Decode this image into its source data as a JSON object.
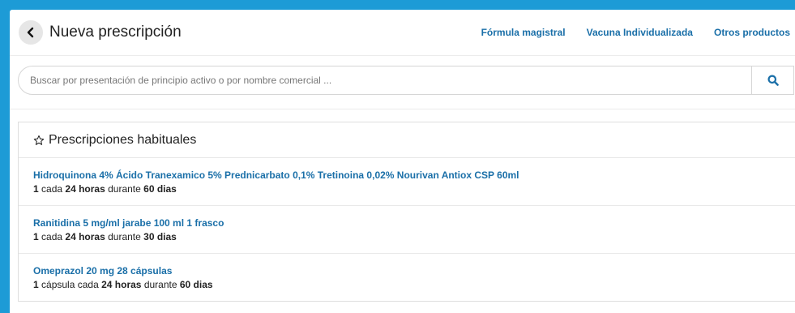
{
  "header": {
    "title": "Nueva prescripción",
    "nav": [
      "Fórmula magistral",
      "Vacuna Individualizada",
      "Otros productos"
    ]
  },
  "search": {
    "placeholder": "Buscar por presentación de principio activo o por nombre comercial ..."
  },
  "habituales": {
    "title": "Prescripciones habituales",
    "items": [
      {
        "name": "Hidroquinona 4% Ácido Tranexamico 5% Prednicarbato 0,1% Tretinoina 0,02% Nourivan Antiox CSP 60ml",
        "qty": "1",
        "unit": "",
        "cada": "cada",
        "frequency": "24 horas",
        "durante": "durante",
        "duration": "60 dias"
      },
      {
        "name": "Ranitidina 5 mg/ml jarabe 100 ml 1 frasco",
        "qty": "1",
        "unit": "",
        "cada": "cada",
        "frequency": "24 horas",
        "durante": "durante",
        "duration": "30 dias"
      },
      {
        "name": "Omeprazol 20 mg 28 cápsulas",
        "qty": "1",
        "unit": "cápsula",
        "cada": "cada",
        "frequency": "24 horas",
        "durante": "durante",
        "duration": "60 dias"
      }
    ]
  },
  "colors": {
    "background": "#1d9bd6",
    "link": "#1a6fa8"
  },
  "icons": {
    "back": "chevron-left-icon",
    "search": "search-icon",
    "star": "star-outline-icon"
  }
}
